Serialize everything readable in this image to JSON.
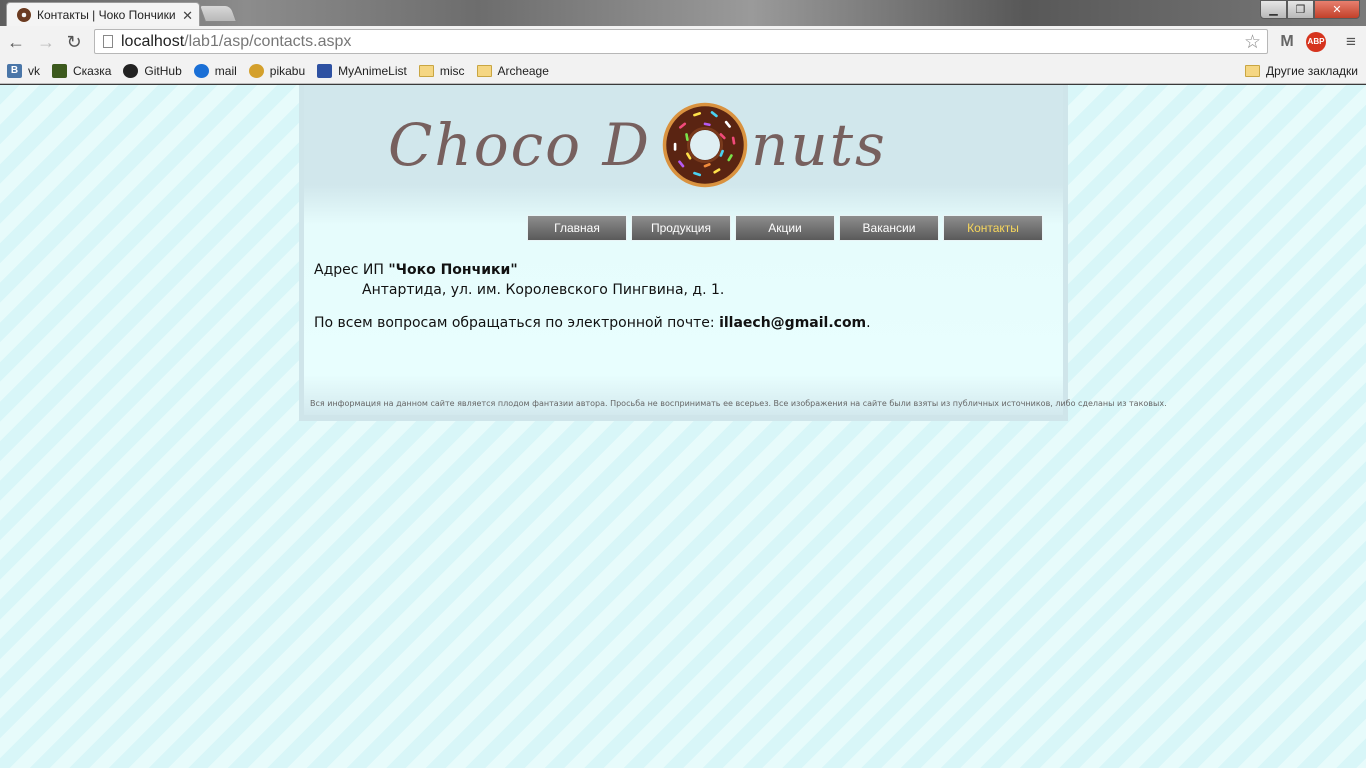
{
  "browser": {
    "tab_title": "Контакты | Чоко Пончики",
    "url_host": "localhost",
    "url_path": "/lab1/asp/contacts.aspx",
    "bookmarks": [
      {
        "label": "vk",
        "icon": "vk-icon"
      },
      {
        "label": "Сказка",
        "icon": "skazka-icon"
      },
      {
        "label": "GitHub",
        "icon": "github-icon"
      },
      {
        "label": "mail",
        "icon": "mail-icon"
      },
      {
        "label": "pikabu",
        "icon": "pikabu-icon"
      },
      {
        "label": "MyAnimeList",
        "icon": "myanimelist-icon"
      },
      {
        "label": "misc",
        "icon": "folder-icon"
      },
      {
        "label": "Archeage",
        "icon": "folder-icon"
      }
    ],
    "other_bookmarks": "Другие закладки"
  },
  "site": {
    "logo_left": "Choco D",
    "logo_right": "nuts",
    "nav": [
      {
        "label": "Главная",
        "active": false
      },
      {
        "label": "Продукция",
        "active": false
      },
      {
        "label": "Акции",
        "active": false
      },
      {
        "label": "Вакансии",
        "active": false
      },
      {
        "label": "Контакты",
        "active": true
      }
    ],
    "address_prefix": "Адрес ИП ",
    "company_name": "\"Чоко Пончики\"",
    "address": "Антартида, ул. им. Королевского Пингвина, д. 1.",
    "contact_text": "По всем вопросам обращаться по электронной почте: ",
    "email": "illaech@gmail.com",
    "contact_suffix": ".",
    "footer": "Вся информация на данном сайте является плодом фантазии автора. Просьба не воспринимать ее всерьез. Все изображения на сайте были взяты из публичных источников, либо сделаны из таковых."
  },
  "colors": {
    "nav_active_text": "#f7d75c",
    "logo_text": "#77605e",
    "background_stripe_a": "#d8f6f8",
    "background_stripe_b": "#e7fbfb"
  }
}
